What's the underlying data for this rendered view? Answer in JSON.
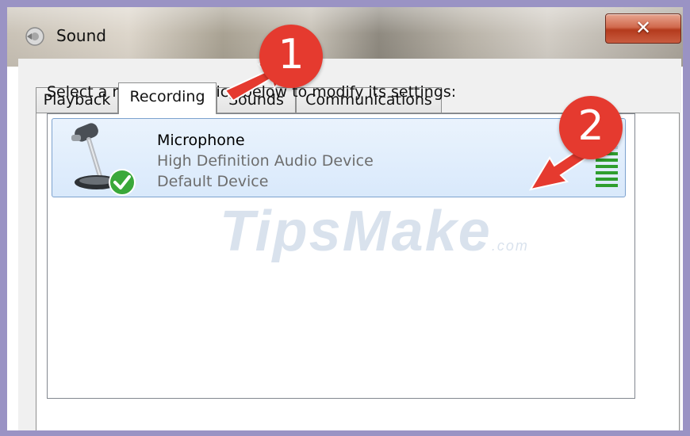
{
  "window": {
    "title": "Sound",
    "close_label": "✕"
  },
  "tabs": [
    {
      "label": "Playback",
      "active": false
    },
    {
      "label": "Recording",
      "active": true
    },
    {
      "label": "Sounds",
      "active": false
    },
    {
      "label": "Communications",
      "active": false
    }
  ],
  "instruction": "Select a recording device below to modify its settings:",
  "device": {
    "name": "Microphone",
    "description": "High Definition Audio Device",
    "status": "Default Device",
    "icon": "microphone-icon",
    "default_badge": "green-check-icon",
    "level_meter": {
      "bars_total": 10,
      "bars_lit": 6
    }
  },
  "annotations": [
    {
      "number": "1",
      "color": "#e53a2f"
    },
    {
      "number": "2",
      "color": "#e53a2f"
    }
  ],
  "watermark": {
    "text": "TipsMake",
    "suffix": ".com"
  }
}
